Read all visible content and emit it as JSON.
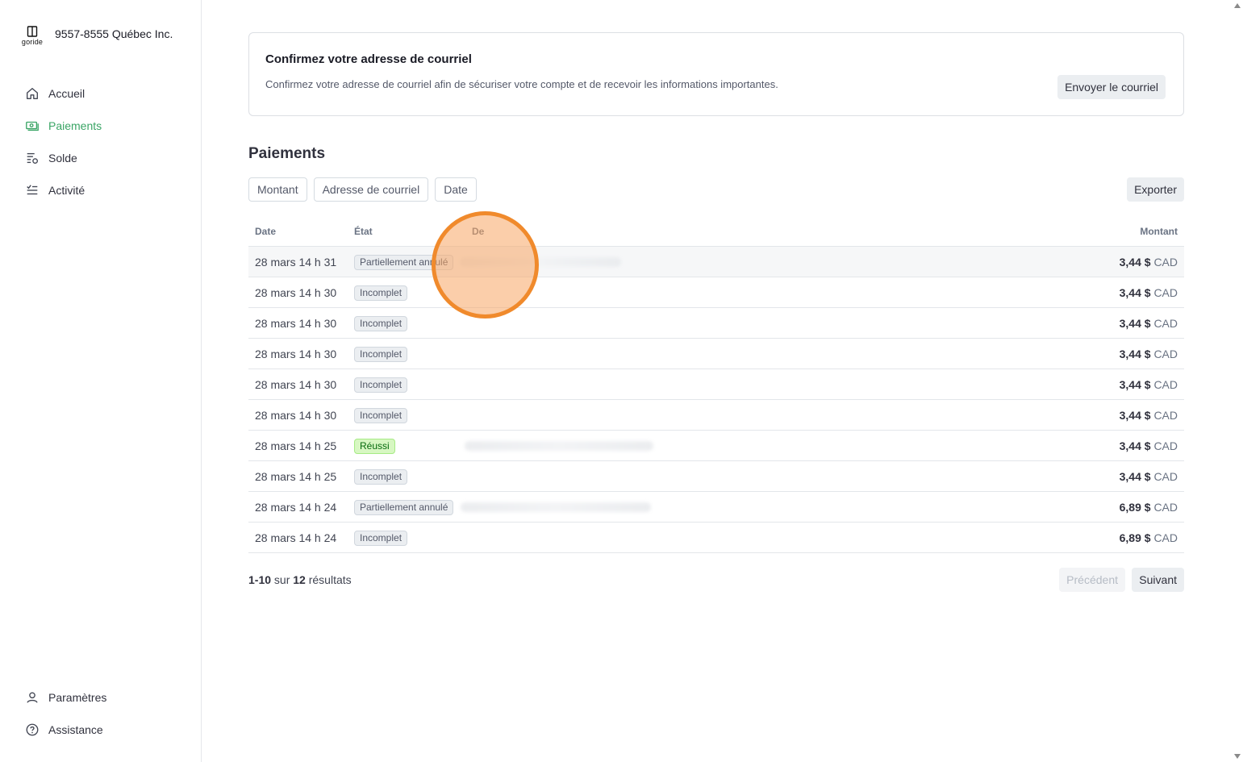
{
  "brand": {
    "logo_text": "goride",
    "company": "9557-8555 Québec Inc."
  },
  "sidebar": {
    "items": [
      {
        "label": "Accueil",
        "icon": "home-icon",
        "active": false
      },
      {
        "label": "Paiements",
        "icon": "payments-icon",
        "active": true
      },
      {
        "label": "Solde",
        "icon": "balance-icon",
        "active": false
      },
      {
        "label": "Activité",
        "icon": "activity-icon",
        "active": false
      }
    ],
    "bottom_items": [
      {
        "label": "Paramètres",
        "icon": "user-icon"
      },
      {
        "label": "Assistance",
        "icon": "help-icon"
      }
    ]
  },
  "banner": {
    "title": "Confirmez votre adresse de courriel",
    "text": "Confirmez votre adresse de courriel afin de sécuriser votre compte et de recevoir les informations importantes.",
    "button": "Envoyer le courriel"
  },
  "payments": {
    "title": "Paiements",
    "filters": [
      "Montant",
      "Adresse de courriel",
      "Date"
    ],
    "export_label": "Exporter",
    "columns": {
      "date": "Date",
      "state": "État",
      "from": "De",
      "amount": "Montant"
    },
    "rows": [
      {
        "date": "28 mars 14 h 31",
        "state": "Partiellement annulé",
        "amount": "3,44 $",
        "currency": "CAD"
      },
      {
        "date": "28 mars 14 h 30",
        "state": "Incomplet",
        "amount": "3,44 $",
        "currency": "CAD"
      },
      {
        "date": "28 mars 14 h 30",
        "state": "Incomplet",
        "amount": "3,44 $",
        "currency": "CAD"
      },
      {
        "date": "28 mars 14 h 30",
        "state": "Incomplet",
        "amount": "3,44 $",
        "currency": "CAD"
      },
      {
        "date": "28 mars 14 h 30",
        "state": "Incomplet",
        "amount": "3,44 $",
        "currency": "CAD"
      },
      {
        "date": "28 mars 14 h 30",
        "state": "Incomplet",
        "amount": "3,44 $",
        "currency": "CAD"
      },
      {
        "date": "28 mars 14 h 25",
        "state": "Réussi",
        "amount": "3,44 $",
        "currency": "CAD"
      },
      {
        "date": "28 mars 14 h 25",
        "state": "Incomplet",
        "amount": "3,44 $",
        "currency": "CAD"
      },
      {
        "date": "28 mars 14 h 24",
        "state": "Partiellement annulé",
        "amount": "6,89 $",
        "currency": "CAD"
      },
      {
        "date": "28 mars 14 h 24",
        "state": "Incomplet",
        "amount": "6,89 $",
        "currency": "CAD"
      }
    ],
    "pager": {
      "range": "1-10",
      "sur": "sur",
      "total": "12",
      "suffix": "résultats",
      "prev": "Précédent",
      "next": "Suivant"
    }
  },
  "colors": {
    "accent": "#3aa565",
    "success_badge": "#d7f7c2",
    "click_marker": "#f08a2c"
  }
}
